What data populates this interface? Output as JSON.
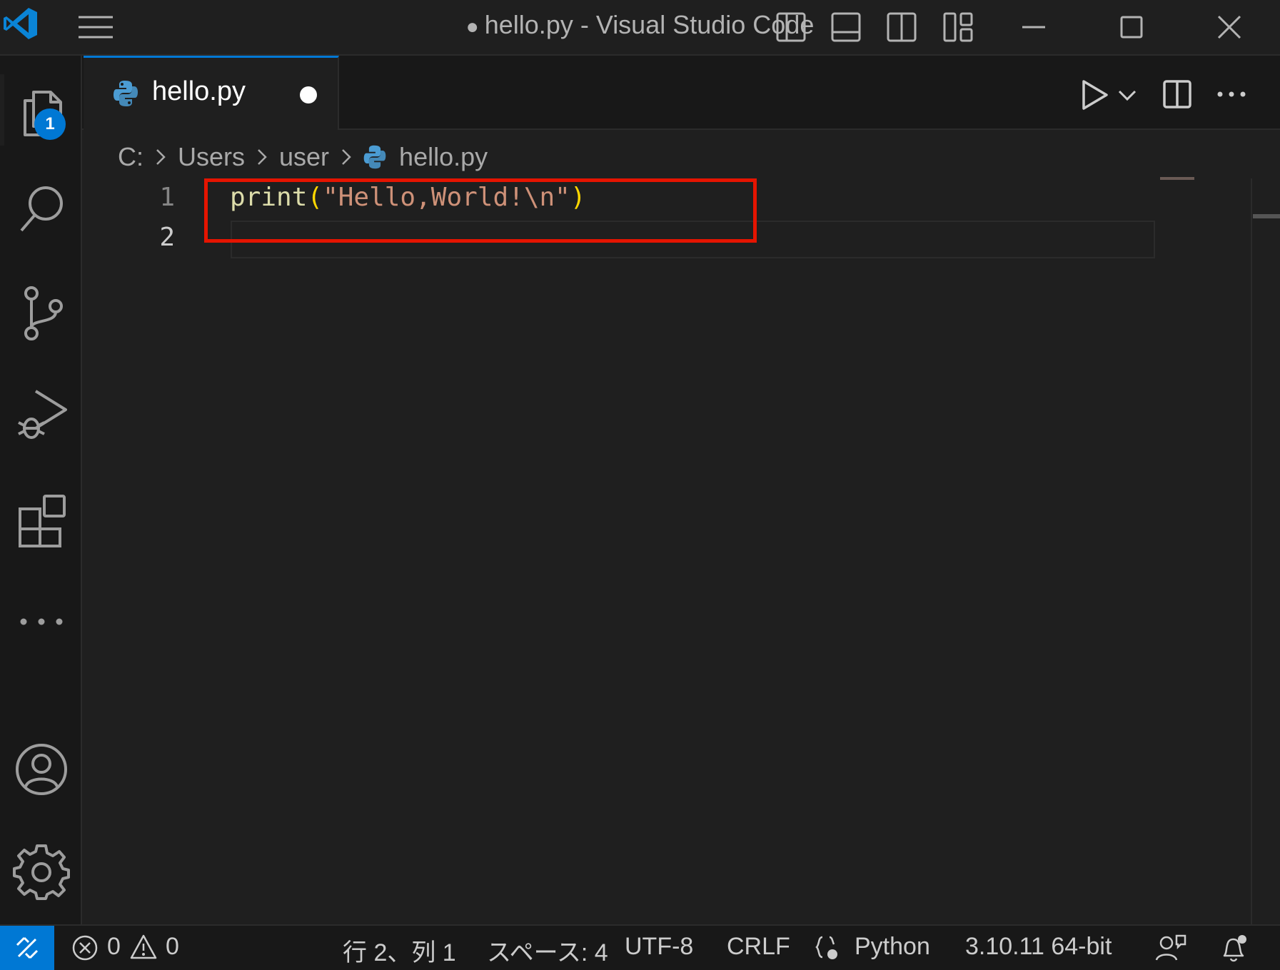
{
  "window": {
    "dirty_dot": "●",
    "title": "hello.py - Visual Studio Code"
  },
  "activity": {
    "explorer_badge": "1"
  },
  "tab": {
    "label": "hello.py"
  },
  "breadcrumb": [
    "C:",
    "Users",
    "user",
    "hello.py"
  ],
  "editor": {
    "line_numbers": [
      "1",
      "2"
    ],
    "line1": {
      "func": "print",
      "open_paren": "(",
      "string": "\"Hello,World!\\n\"",
      "close_paren": ")"
    }
  },
  "statusbar": {
    "errors": "0",
    "warnings": "0",
    "cursor": "行 2、列 1",
    "spaces": "スペース: 4",
    "encoding": "UTF-8",
    "eol": "CRLF",
    "language": "Python",
    "interpreter": "3.10.11 64-bit"
  },
  "colors": {
    "accent": "#0078d4",
    "highlight": "#e51400",
    "func": "#dcdcaa",
    "paren": "#ffd700",
    "string": "#ce9178"
  }
}
